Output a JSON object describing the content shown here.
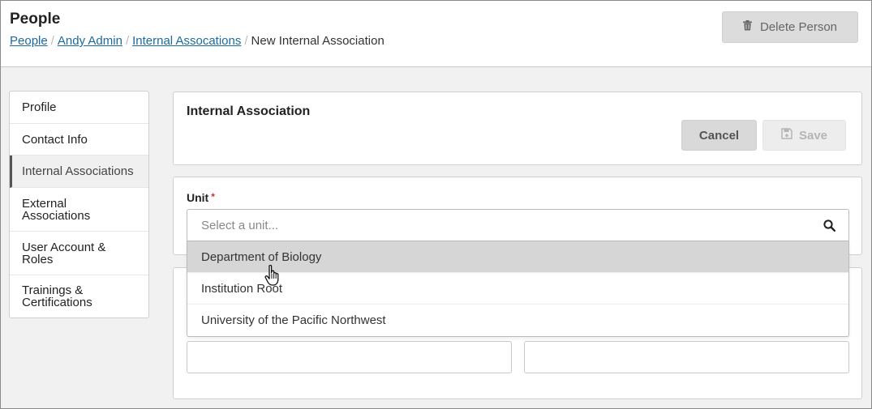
{
  "header": {
    "title": "People",
    "breadcrumb": [
      {
        "label": "People",
        "link": true
      },
      {
        "label": "Andy Admin",
        "link": true
      },
      {
        "label": "Internal Assocations",
        "link": true
      },
      {
        "label": "New Internal Association",
        "link": false
      }
    ],
    "breadcrumb_separator": "/",
    "delete_button": "Delete Person"
  },
  "sidebar": {
    "items": [
      {
        "label": "Profile",
        "active": false
      },
      {
        "label": "Contact Info",
        "active": false
      },
      {
        "label": "Internal Associations",
        "active": true
      },
      {
        "label": "External Associations",
        "active": false
      },
      {
        "label": "User Account & Roles",
        "active": false
      },
      {
        "label": "Trainings & Certifications",
        "active": false
      }
    ]
  },
  "form": {
    "title": "Internal Association",
    "cancel_label": "Cancel",
    "save_label": "Save",
    "unit_label": "Unit",
    "required_mark": "*",
    "unit_placeholder": "Select a unit...",
    "unit_options": [
      "Department of Biology",
      "Institution Root",
      "University of the Pacific Northwest"
    ],
    "hovered_option": "Department of Biology"
  },
  "icons": {
    "delete": "trash-icon",
    "save": "floppy-disk-icon",
    "search": "search-icon",
    "cursor": "hand-pointer-cursor"
  },
  "colors": {
    "link": "#1a6aa0",
    "required": "#cc3333",
    "hover_option": "#d6d6d6",
    "button_gray": "#d9d9d9"
  }
}
